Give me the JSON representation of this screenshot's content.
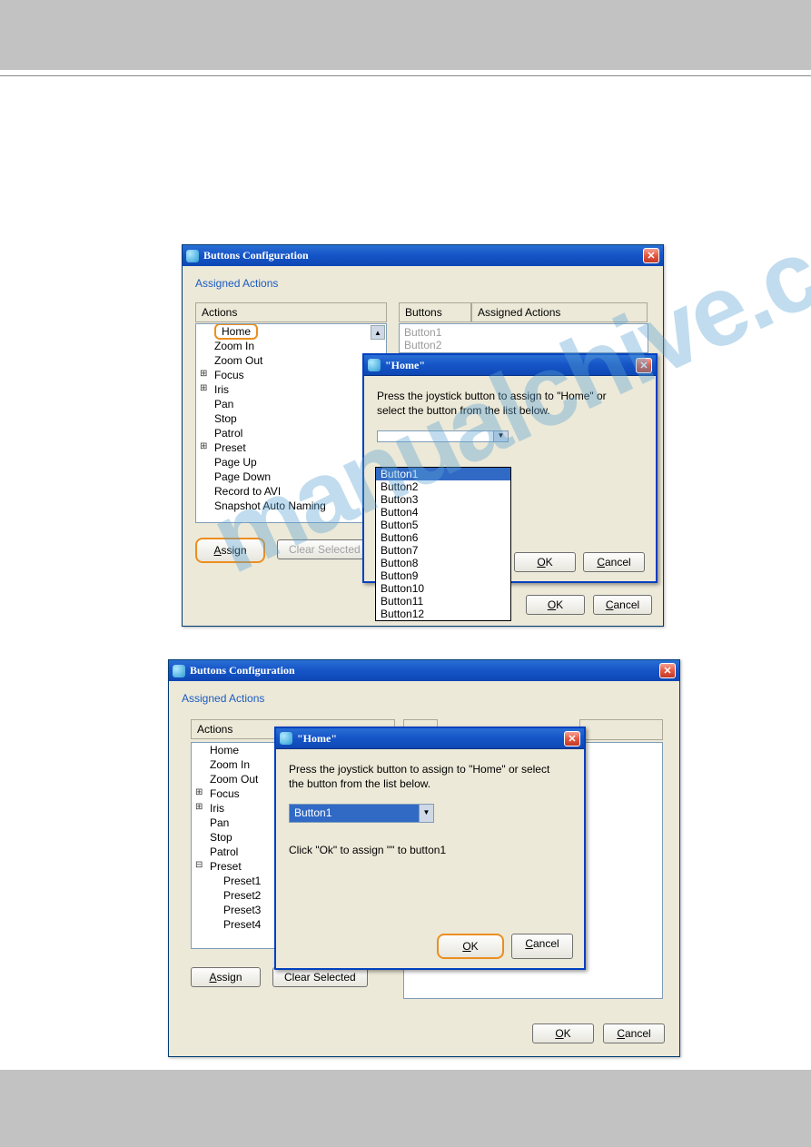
{
  "watermark_text": "manualchive.com",
  "window1": {
    "title": "Buttons Configuration",
    "group_label": "Assigned Actions",
    "actions_header": "Actions",
    "buttons_header": "Buttons",
    "assigned_header": "Assigned Actions",
    "tree": [
      "Home",
      "Zoom In",
      "Zoom Out",
      "Focus",
      "Iris",
      "Pan",
      "Stop",
      "Patrol",
      "Preset",
      "Page Up",
      "Page Down",
      "Record to AVI",
      "Snapshot Auto Naming"
    ],
    "right_list": [
      "Button1",
      "Button2"
    ],
    "assign_btn": "Assign",
    "clear_btn": "Clear Selected",
    "ok_btn": "OK",
    "cancel_btn": "Cancel"
  },
  "popup1": {
    "title": "\"Home\"",
    "message": "Press the joystick button to assign to \"Home\" or select the button from the list below.",
    "options": [
      "Button1",
      "Button2",
      "Button3",
      "Button4",
      "Button5",
      "Button6",
      "Button7",
      "Button8",
      "Button9",
      "Button10",
      "Button11",
      "Button12"
    ],
    "ok_btn": "OK",
    "cancel_btn": "Cancel"
  },
  "window2": {
    "title": "Buttons Configuration",
    "group_label": "Assigned Actions",
    "actions_header": "Actions",
    "tree": [
      "Home",
      "Zoom In",
      "Zoom Out",
      "Focus",
      "Iris",
      "Pan",
      "Stop",
      "Patrol",
      "Preset"
    ],
    "preset_children": [
      "Preset1",
      "Preset2",
      "Preset3",
      "Preset4"
    ],
    "assign_btn": "Assign",
    "clear_btn": "Clear Selected",
    "ok_btn": "OK",
    "cancel_btn": "Cancel"
  },
  "popup2": {
    "title": "\"Home\"",
    "message": "Press the joystick button to assign to \"Home\" or select the button from the list below.",
    "selected": "Button1",
    "confirm_text": "Click \"Ok\" to assign \"\" to button1",
    "ok_btn": "OK",
    "cancel_btn": "Cancel"
  }
}
